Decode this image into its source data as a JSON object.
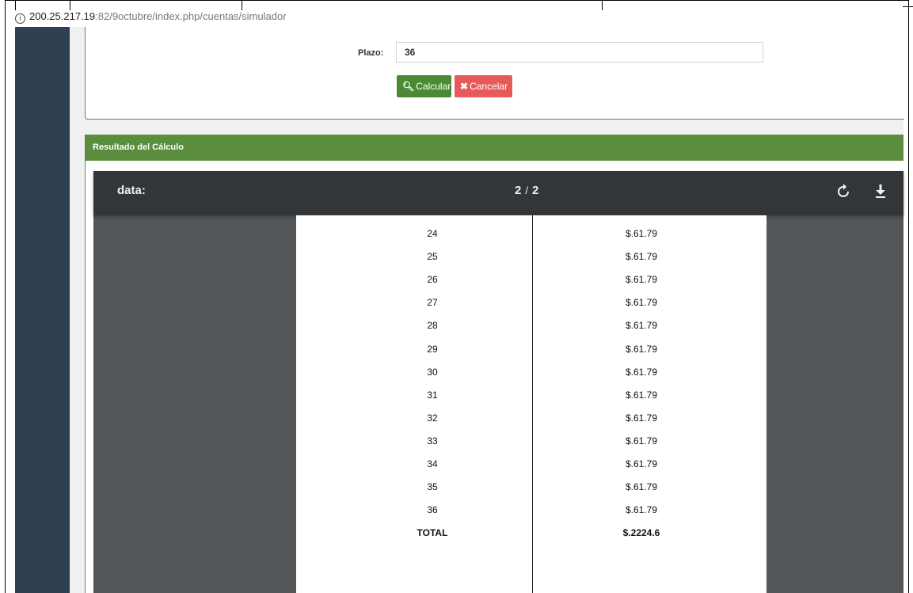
{
  "browser": {
    "url_host": "200.25.217.19",
    "url_path": ":82/9octubre/index.php/cuentas/simulador"
  },
  "form": {
    "plazo_label": "Plazo:",
    "plazo_value": "36",
    "calcular_label": "Calcular",
    "cancelar_label": "Cancelar"
  },
  "result": {
    "header": "Resultado del Cálculo"
  },
  "viewer": {
    "title": "data:",
    "current_page": "2",
    "total_pages": "2"
  },
  "table": {
    "rows": [
      {
        "n": "24",
        "v": "$.61.79"
      },
      {
        "n": "25",
        "v": "$.61.79"
      },
      {
        "n": "26",
        "v": "$.61.79"
      },
      {
        "n": "27",
        "v": "$.61.79"
      },
      {
        "n": "28",
        "v": "$.61.79"
      },
      {
        "n": "29",
        "v": "$.61.79"
      },
      {
        "n": "30",
        "v": "$.61.79"
      },
      {
        "n": "31",
        "v": "$.61.79"
      },
      {
        "n": "32",
        "v": "$.61.79"
      },
      {
        "n": "33",
        "v": "$.61.79"
      },
      {
        "n": "34",
        "v": "$.61.79"
      },
      {
        "n": "35",
        "v": "$.61.79"
      },
      {
        "n": "36",
        "v": "$.61.79"
      }
    ],
    "total_label": "TOTAL",
    "total_value": "$.2224.6"
  }
}
